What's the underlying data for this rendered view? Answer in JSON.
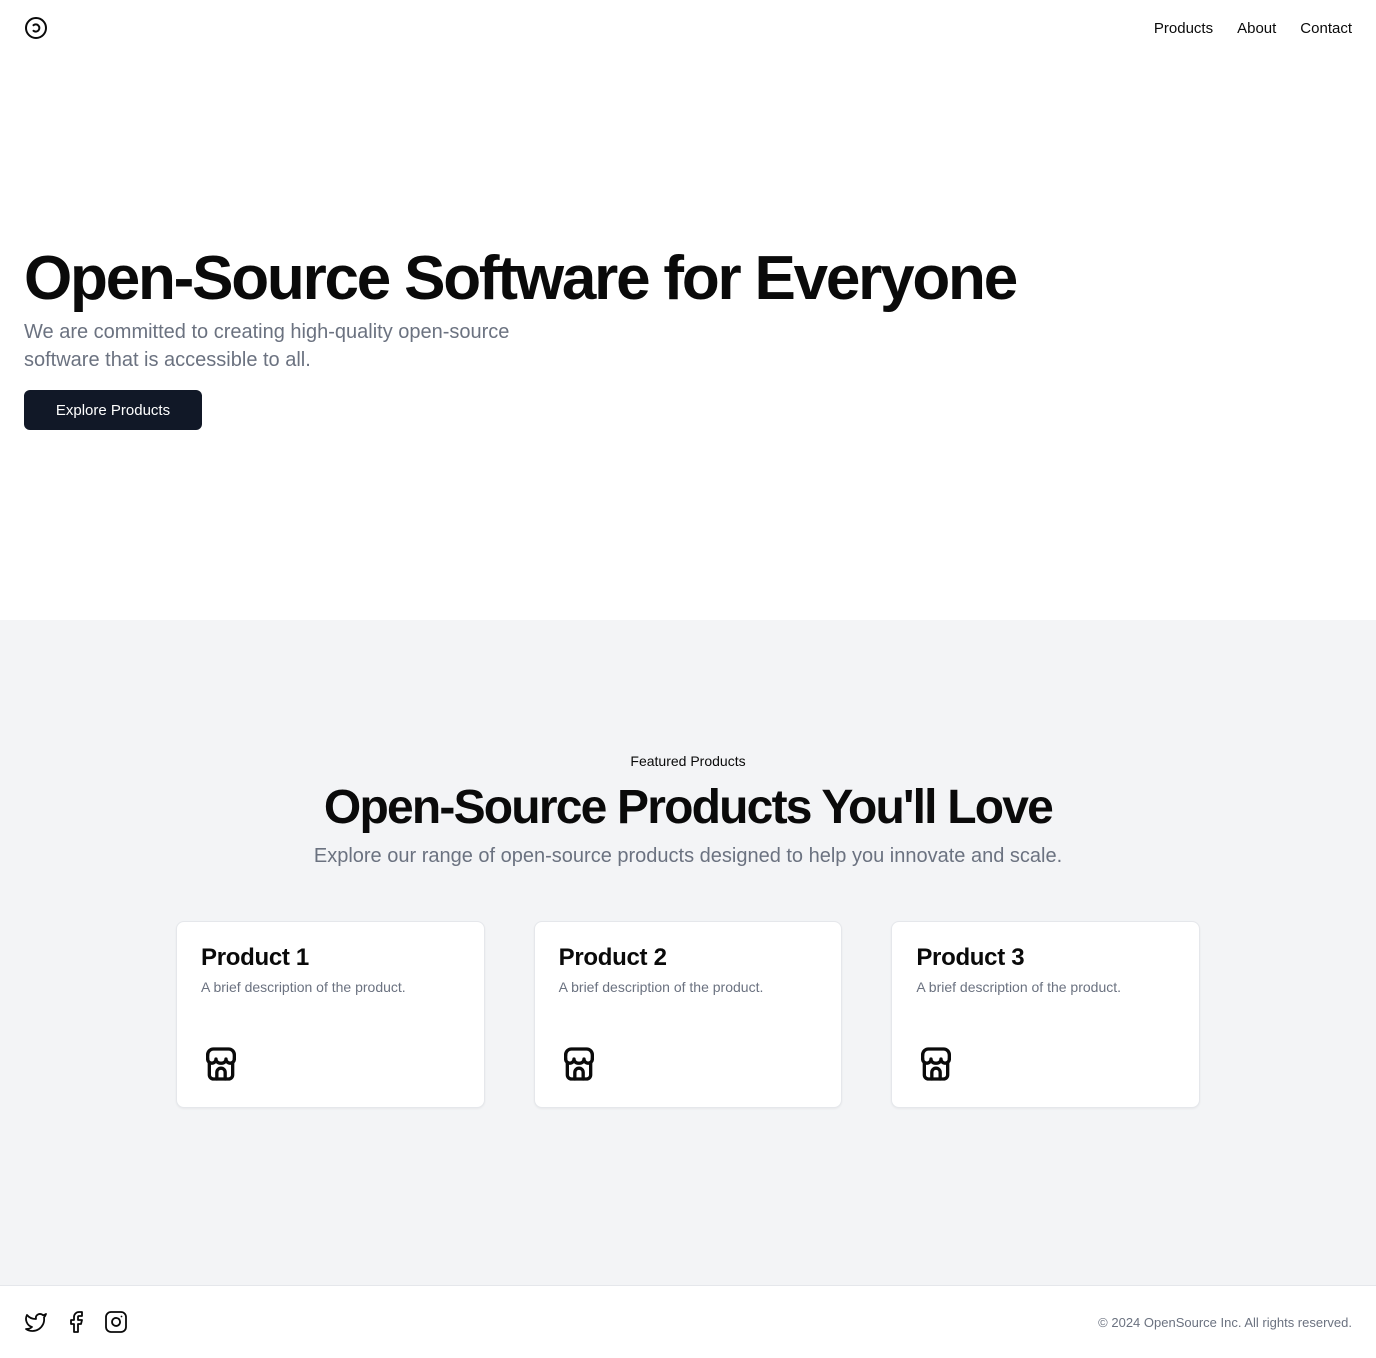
{
  "header": {
    "logo_icon": "copyleft-icon",
    "nav": [
      {
        "label": "Products"
      },
      {
        "label": "About"
      },
      {
        "label": "Contact"
      }
    ]
  },
  "hero": {
    "title": "Open-Source Software for Everyone",
    "subtitle": "We are committed to creating high-quality open-source software that is accessible to all.",
    "button_label": "Explore Products"
  },
  "featured": {
    "eyebrow": "Featured Products",
    "title": "Open-Source Products You'll Love",
    "subtitle": "Explore our range of open-source products designed to help you innovate and scale.",
    "products": [
      {
        "title": "Product 1",
        "description": "A brief description of the product.",
        "icon": "store-icon"
      },
      {
        "title": "Product 2",
        "description": "A brief description of the product.",
        "icon": "store-icon"
      },
      {
        "title": "Product 3",
        "description": "A brief description of the product.",
        "icon": "store-icon"
      }
    ]
  },
  "footer": {
    "socials": [
      "twitter-icon",
      "facebook-icon",
      "instagram-icon"
    ],
    "copyright": "© 2024 OpenSource Inc. All rights reserved."
  },
  "colors": {
    "primary": "#111827",
    "muted_text": "#6b7280",
    "section_bg": "#f3f4f6"
  }
}
